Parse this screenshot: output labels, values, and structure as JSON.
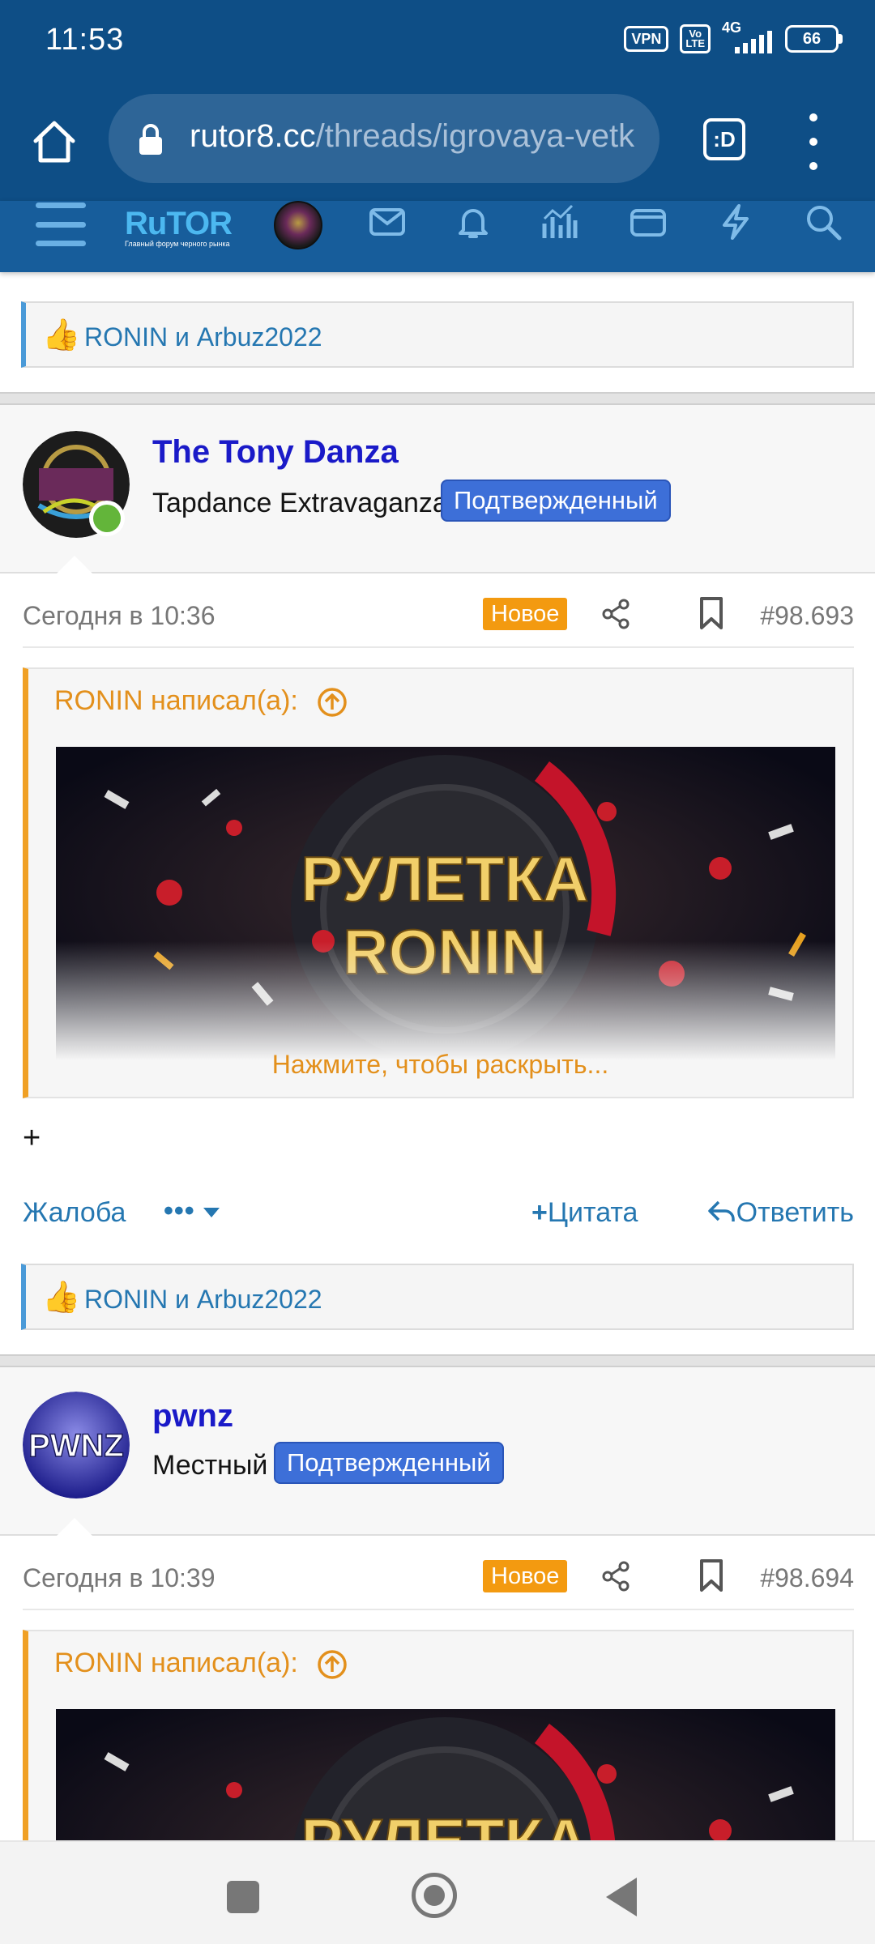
{
  "status_bar": {
    "time": "11:53",
    "vpn": "VPN",
    "volte_top": "Vo",
    "volte_bottom": "LTE",
    "network": "4G",
    "battery": "66"
  },
  "browser": {
    "url_host": "rutor8.cc",
    "url_path": "/threads/igrovaya-vetk",
    "tabs_label": ":D"
  },
  "forum_nav": {
    "logo_main": "RuTOR",
    "logo_sub": "Главный форум черного рынка",
    "icons": [
      "menu-icon",
      "mail-icon",
      "bell-icon",
      "chart-icon",
      "wallet-icon",
      "lightning-icon",
      "search-icon"
    ]
  },
  "top_reaction": {
    "thumb": "👍",
    "names": "RONIN и Arbuz2022"
  },
  "posts": [
    {
      "username": "The Tony Danza",
      "user_title": "Tapdance Extravaganza",
      "badge": "Подтвержденный",
      "date": "Сегодня в 10:36",
      "new_label": "Новое",
      "post_number": "#98.693",
      "quote_author": "RONIN написал(а):",
      "banner_text_line1": "РУЛЕТКА",
      "banner_text_line2": "RONIN",
      "expand_label": "Нажмите, чтобы раскрыть...",
      "body": "+",
      "actions": {
        "report": "Жалоба",
        "more": "•••",
        "quote": "Цитата",
        "reply": "Ответить"
      },
      "reaction_thumb": "👍",
      "reaction_names": "RONIN и Arbuz2022"
    },
    {
      "username": "pwnz",
      "user_title": "Местный",
      "badge": "Подтвержденный",
      "avatar_text": "PWNZ",
      "date": "Сегодня в 10:39",
      "new_label": "Новое",
      "post_number": "#98.694",
      "quote_author": "RONIN написал(а):",
      "banner_text_line1": "РУЛЕТКА"
    }
  ],
  "colors": {
    "status_bar_bg": "#0e4e86",
    "forum_nav_bg": "#175d9b",
    "link_blue": "#2577b1",
    "username_blue": "#1a1ac8",
    "badge_blue": "#3d6fd8",
    "new_tag_orange": "#f39a10",
    "quote_orange": "#e3901c"
  }
}
